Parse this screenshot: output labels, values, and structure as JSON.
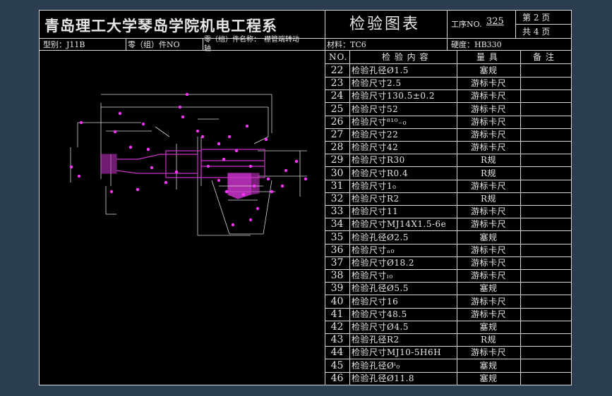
{
  "header": {
    "school": "青岛理工大学琴岛学院机电工程系",
    "form_title": "检验图表",
    "process_label": "工序NO.",
    "process_no": "325",
    "page_label": "第 2 页",
    "total_label": "共 4 页"
  },
  "info": {
    "model": "型别：J11B",
    "part_no": "零（组）件NO",
    "part_name_line1": "零（组）件名称：　襟管端转动",
    "part_name_line2": "轴",
    "material": "材料：TC6",
    "hardness": "硬度：HB330"
  },
  "table": {
    "col_no": "NO.",
    "col_content": "检 验 内 容",
    "col_tool": "量 具",
    "col_note": "备 注",
    "rows": [
      {
        "no": "22",
        "content": "检验孔径Ø1.5",
        "tool": "塞规"
      },
      {
        "no": "23",
        "content": "检验尺寸2.5",
        "tool": "游标卡尺"
      },
      {
        "no": "24",
        "content": "检验尺寸130.5±0.2",
        "tool": "游标卡尺"
      },
      {
        "no": "25",
        "content": "检验尺寸52",
        "tool": "游标卡尺"
      },
      {
        "no": "26",
        "content": "检验尺寸⁸¹⁰₋₀",
        "tool": "游标卡尺"
      },
      {
        "no": "27",
        "content": "检验尺寸22",
        "tool": "游标卡尺"
      },
      {
        "no": "28",
        "content": "检验尺寸42",
        "tool": "游标卡尺"
      },
      {
        "no": "29",
        "content": "检验尺寸R30",
        "tool": "R规"
      },
      {
        "no": "30",
        "content": "检验尺寸R0.4",
        "tool": "R规"
      },
      {
        "no": "31",
        "content": "检验尺寸1₀",
        "tool": "游标卡尺"
      },
      {
        "no": "32",
        "content": "检验尺寸R2",
        "tool": "R规"
      },
      {
        "no": "33",
        "content": "检验尺寸11",
        "tool": "游标卡尺"
      },
      {
        "no": "34",
        "content": "检验尺寸MJ14X1.5-6e",
        "tool": "游标卡尺"
      },
      {
        "no": "35",
        "content": "检验孔径Ø2.5",
        "tool": "塞规"
      },
      {
        "no": "36",
        "content": "检验尺寸ₙ₀",
        "tool": "游标卡尺"
      },
      {
        "no": "37",
        "content": "检验尺寸Ø18.2",
        "tool": "游标卡尺"
      },
      {
        "no": "38",
        "content": "检验尺寸ₗ₀",
        "tool": "游标卡尺"
      },
      {
        "no": "39",
        "content": "检验孔径Ø5.5",
        "tool": "塞规"
      },
      {
        "no": "40",
        "content": "检验尺寸16",
        "tool": "游标卡尺"
      },
      {
        "no": "41",
        "content": "检验尺寸48.5",
        "tool": "游标卡尺"
      },
      {
        "no": "42",
        "content": "检验尺寸Ø4.5",
        "tool": "塞规"
      },
      {
        "no": "43",
        "content": "检验孔径R2",
        "tool": "R规"
      },
      {
        "no": "44",
        "content": "检验尺寸MJ10-5H6H",
        "tool": "游标卡尺"
      },
      {
        "no": "45",
        "content": "检验孔径Øⁱ₀",
        "tool": "塞规"
      },
      {
        "no": "46",
        "content": "检验孔径Ø11.8",
        "tool": "塞规"
      }
    ]
  },
  "colors": {
    "background": "#2b3d50",
    "sheet": "#000000",
    "lines": "#d8d8d8",
    "callout": "#ff33ff",
    "part": "#cc33cc"
  }
}
